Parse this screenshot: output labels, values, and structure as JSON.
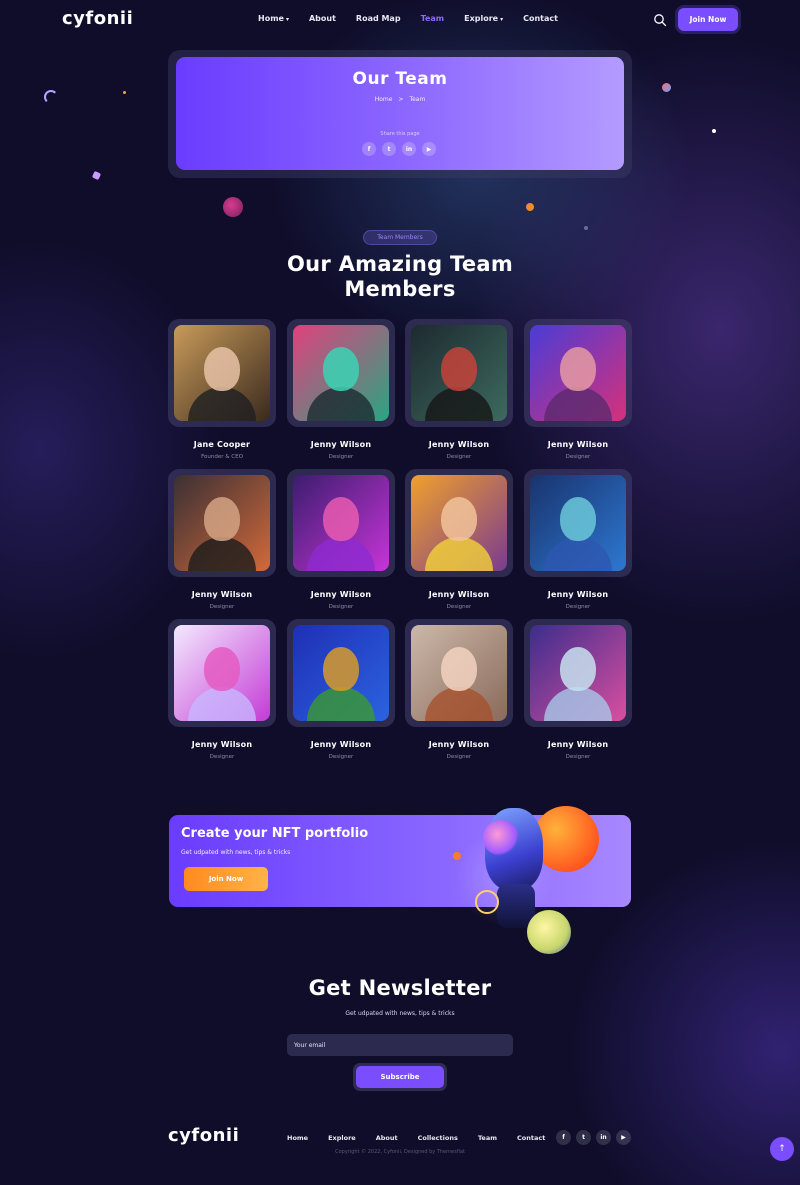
{
  "header": {
    "logo": "cyfonii",
    "nav": [
      {
        "label": "Home",
        "caret": "▾"
      },
      {
        "label": "About",
        "caret": ""
      },
      {
        "label": "Road Map",
        "caret": ""
      },
      {
        "label": "Team",
        "caret": ""
      },
      {
        "label": "Explore",
        "caret": "▾"
      },
      {
        "label": "Contact",
        "caret": ""
      }
    ],
    "active_nav": "Team",
    "search_icon": "search-icon",
    "join_label": "Join Now"
  },
  "hero": {
    "title": "Our Team",
    "breadcrumb": {
      "home": "Home",
      "separator": ">",
      "current": "Team"
    },
    "share_label": "Share this page",
    "share_icons": [
      {
        "name": "facebook-icon",
        "glyph": "f"
      },
      {
        "name": "twitter-icon",
        "glyph": "t"
      },
      {
        "name": "linkedin-icon",
        "glyph": "in"
      },
      {
        "name": "youtube-icon",
        "glyph": "▶"
      }
    ]
  },
  "team_section": {
    "pill": "Team Members",
    "title_line1": "Our Amazing Team",
    "title_line2": "Members",
    "members": [
      {
        "name": "Jane Cooper",
        "role": "Founder & CEO",
        "bg": [
          "#c89a5a",
          "#3a2a1e"
        ],
        "face": "#e8c2a6",
        "body": "#1f1f22"
      },
      {
        "name": "Jenny Wilson",
        "role": "Designer",
        "bg": [
          "#e0417e",
          "#2aa582"
        ],
        "face": "#3bd3b5",
        "body": "#1c2b30"
      },
      {
        "name": "Jenny Wilson",
        "role": "Designer",
        "bg": [
          "#1d2a30",
          "#3d6a5e"
        ],
        "face": "#c6433b",
        "body": "#151515"
      },
      {
        "name": "Jenny Wilson",
        "role": "Designer",
        "bg": [
          "#4a3cd6",
          "#d5317b"
        ],
        "face": "#e59aa2",
        "body": "#5a2a6e"
      },
      {
        "name": "Jenny Wilson",
        "role": "Designer",
        "bg": [
          "#3a3034",
          "#d2693a"
        ],
        "face": "#d4a384",
        "body": "#1b1b1b"
      },
      {
        "name": "Jenny Wilson",
        "role": "Designer",
        "bg": [
          "#3c1d6e",
          "#c734d8"
        ],
        "face": "#e85ab0",
        "body": "#8d2ad1"
      },
      {
        "name": "Jenny Wilson",
        "role": "Designer",
        "bg": [
          "#f0a02b",
          "#7a3b8f"
        ],
        "face": "#f1c39a",
        "body": "#f3d23a"
      },
      {
        "name": "Jenny Wilson",
        "role": "Designer",
        "bg": [
          "#19336d",
          "#2d78d1"
        ],
        "face": "#6bc8d8",
        "body": "#2e56b0"
      },
      {
        "name": "Jenny Wilson",
        "role": "Designer",
        "bg": [
          "#f3e9ff",
          "#c43bd6"
        ],
        "face": "#e45bc2",
        "body": "#c8b6ff"
      },
      {
        "name": "Jenny Wilson",
        "role": "Designer",
        "bg": [
          "#1f2fb5",
          "#2b63e0"
        ],
        "face": "#d79a2a",
        "body": "#3b9a30"
      },
      {
        "name": "Jenny Wilson",
        "role": "Designer",
        "bg": [
          "#cbb8aa",
          "#8a6a5a"
        ],
        "face": "#f2d2c0",
        "body": "#a5512e"
      },
      {
        "name": "Jenny Wilson",
        "role": "Designer",
        "bg": [
          "#3b2d8c",
          "#d94fa0"
        ],
        "face": "#c7e2ef",
        "body": "#a6c8e8"
      }
    ]
  },
  "nft_banner": {
    "title": "Create your NFT portfolio",
    "subtitle": "Get udpated with news, tips & tricks",
    "button": "Join Now"
  },
  "newsletter": {
    "title": "Get Newsletter",
    "subtitle": "Get udpated with news, tips & tricks",
    "email_placeholder": "Your email",
    "button": "Subscribe"
  },
  "footer": {
    "logo": "cyfonii",
    "nav": [
      "Home",
      "Explore",
      "About",
      "Collections",
      "Team",
      "Contact"
    ],
    "social": [
      {
        "name": "facebook-icon",
        "glyph": "f"
      },
      {
        "name": "twitter-icon",
        "glyph": "t"
      },
      {
        "name": "linkedin-icon",
        "glyph": "in"
      },
      {
        "name": "youtube-icon",
        "glyph": "▶"
      }
    ],
    "copyright": "Copyright © 2022, Cyfonii, Designed by Themesflat",
    "back_to_top": "↑"
  }
}
